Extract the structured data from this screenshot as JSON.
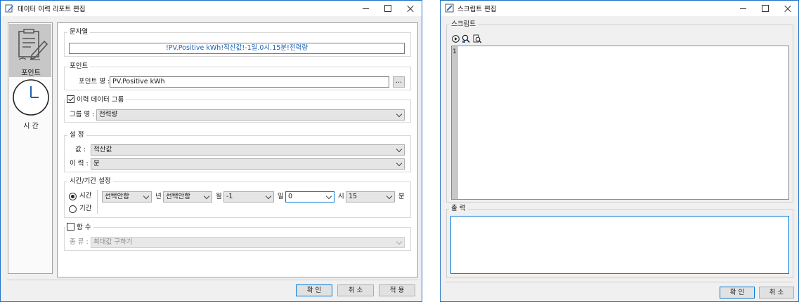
{
  "report_window": {
    "title": "데이터 이력 리포트 편집",
    "sidebar": {
      "items": [
        {
          "label": "포인트",
          "icon": "document-pencil-icon",
          "selected": true
        },
        {
          "label": "시 간",
          "icon": "clock-icon",
          "selected": false
        }
      ]
    },
    "string_group": {
      "title": "문자열",
      "value": "!PV.Positive kWh!적산값!-1일.0시.15분!전력량"
    },
    "point_group": {
      "title": "포인트",
      "name_label": "포인트 명 :",
      "name_value": "PV.Positive kWh",
      "browse_label": "..."
    },
    "history_group": {
      "title": "이력 데이터 그룹",
      "checked": true,
      "group_label": "그룹 명 :",
      "group_value": "전력량"
    },
    "settings_group": {
      "title": "설 정",
      "value_label": "값 :",
      "value_selected": "적산값",
      "history_label": "이 력 :",
      "history_selected": "분"
    },
    "time_group": {
      "title": "시간/기간 설정",
      "radio_time": "시간",
      "radio_period": "기간",
      "selected_radio": "시간",
      "year_value": "선택안함",
      "year_unit": "년",
      "month_value": "선택안함",
      "month_unit": "월",
      "day_value": "-1",
      "day_unit": "일",
      "hour_value": "0",
      "hour_unit": "시",
      "minute_value": "15",
      "minute_unit": "분"
    },
    "function_group": {
      "title": "함 수",
      "checked": false,
      "type_label": "종 류 :",
      "type_value": "최대값 구하기"
    },
    "buttons": {
      "ok": "확 인",
      "cancel": "취 소",
      "apply": "적 용"
    }
  },
  "script_window": {
    "title": "스크립트 편집",
    "script_group": {
      "title": "스크립트",
      "toolbar": [
        "run-icon",
        "find-icon",
        "preview-icon"
      ],
      "line_number": "1"
    },
    "output_group": {
      "title": "출 력"
    },
    "buttons": {
      "ok": "확 인",
      "cancel": "취 소"
    }
  },
  "colors": {
    "accent": "#0078d7",
    "string_text": "#1a5fb4",
    "window_border": "#1f72c8"
  }
}
